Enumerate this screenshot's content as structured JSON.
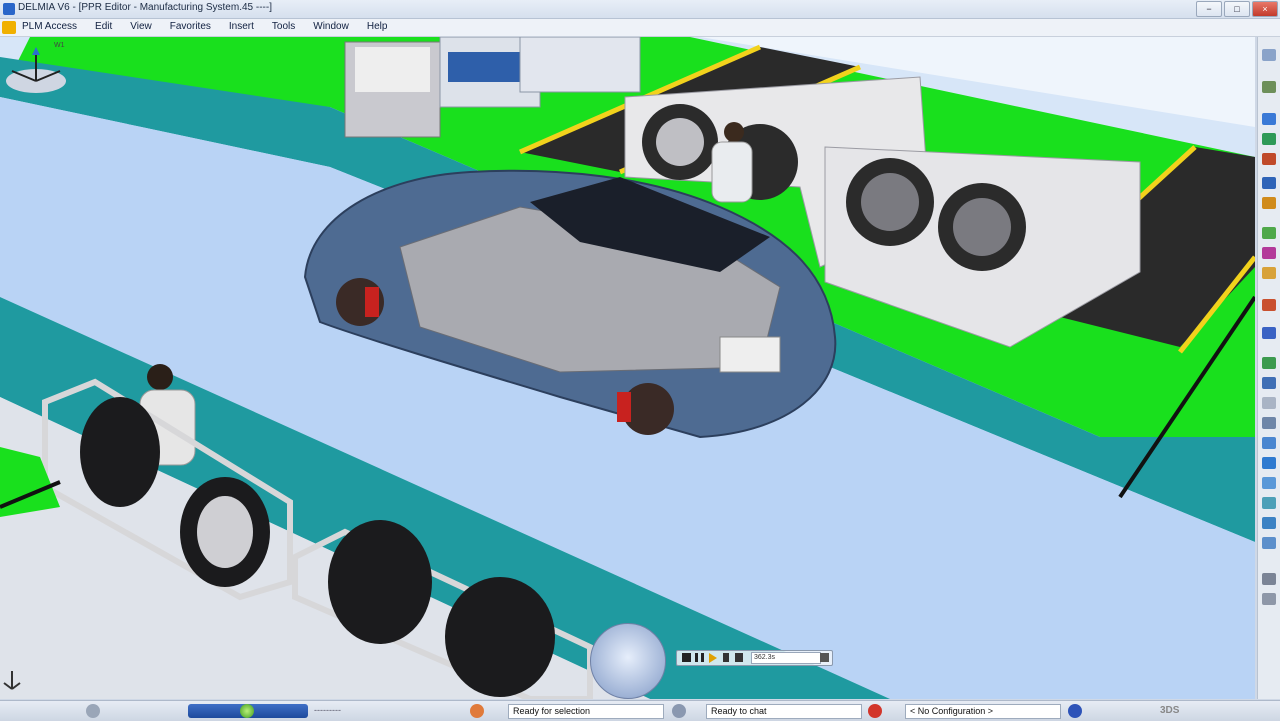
{
  "window": {
    "title": "DELMIA V6 - [PPR Editor - Manufacturing System.45 ----]",
    "buttons": [
      "−",
      "□",
      "×"
    ]
  },
  "menu": {
    "items": [
      "PLM Access",
      "Edit",
      "View",
      "Favorites",
      "Insert",
      "Tools",
      "Window",
      "Help"
    ]
  },
  "viewport": {
    "scene": "3d-assembly-line",
    "compass_label": "W1"
  },
  "player": {
    "time": "362.3s"
  },
  "status": {
    "field1": "---------",
    "field2": "Ready for selection",
    "field3": "Ready to chat",
    "field4": "< No Configuration >",
    "brand": "3DS"
  },
  "colors": {
    "floor_green": "#19e01d",
    "aisle_blue": "#b9d3f5",
    "teal": "#1f9aa0",
    "car_body": "#4e6b92",
    "rail_yellow": "#f2d21c"
  }
}
